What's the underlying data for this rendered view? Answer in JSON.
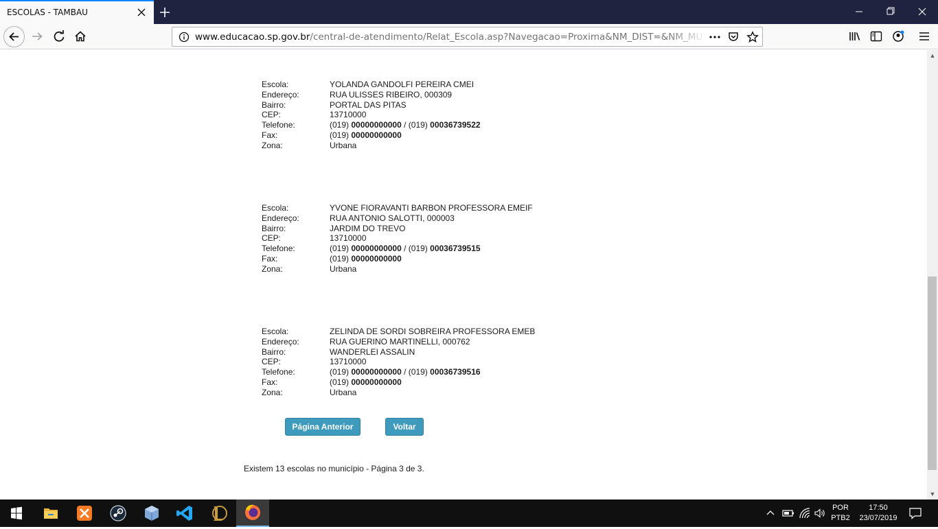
{
  "browser": {
    "tab_title": "ESCOLAS - TAMBAU",
    "url_host": "www.educacao.sp.gov.br",
    "url_rest": "/central-de-atendimento/Relat_Escola.asp?Navegacao=Proxima&NM_DIST=&NM_MUN=TA"
  },
  "labels": {
    "escola": "Escola:",
    "endereco": "Endereço:",
    "bairro": "Bairro:",
    "cep": "CEP:",
    "telefone": "Telefone:",
    "fax": "Fax:",
    "zona": "Zona:"
  },
  "schools": [
    {
      "escola": "YOLANDA GANDOLFI PEREIRA CMEI",
      "endereco": "RUA ULISSES RIBEIRO, 000309",
      "bairro": "PORTAL DAS PITAS",
      "cep": "13710000",
      "tel_ddd1": "(019) ",
      "tel_num1": "00000000000",
      "tel_sep": " / (019) ",
      "tel_num2": "00036739522",
      "fax_ddd": "(019) ",
      "fax_num": "00000000000",
      "zona": "Urbana"
    },
    {
      "escola": "YVONE FIORAVANTI BARBON PROFESSORA EMEIF",
      "endereco": "RUA ANTONIO SALOTTI, 000003",
      "bairro": "JARDIM DO TREVO",
      "cep": "13710000",
      "tel_ddd1": "(019) ",
      "tel_num1": "00000000000",
      "tel_sep": " / (019) ",
      "tel_num2": "00036739515",
      "fax_ddd": "(019) ",
      "fax_num": "00000000000",
      "zona": "Urbana"
    },
    {
      "escola": "ZELINDA DE SORDI SOBREIRA PROFESSORA EMEB",
      "endereco": "RUA GUERINO MARTINELLI, 000762",
      "bairro": "WANDERLEI ASSALIN",
      "cep": "13710000",
      "tel_ddd1": "(019) ",
      "tel_num1": "00000000000",
      "tel_sep": " / (019) ",
      "tel_num2": "00036739516",
      "fax_ddd": "(019) ",
      "fax_num": "00000000000",
      "zona": "Urbana"
    }
  ],
  "buttons": {
    "previous": "Página Anterior",
    "back": "Voltar"
  },
  "footer": "Existem 13 escolas no município - Página 3 de 3.",
  "taskbar": {
    "lang_top": "POR",
    "lang_bottom": "PTB2",
    "time": "17:50",
    "date": "23/07/2019",
    "apps": [
      "windows-start-icon",
      "file-explorer-icon",
      "xampp-icon",
      "steam-icon",
      "virtualbox-icon",
      "vscode-icon",
      "league-of-legends-icon",
      "firefox-icon"
    ]
  },
  "colors": {
    "button_bg": "#3e9bbd",
    "tabbar_bg": "#202340",
    "accent": "#0a84ff"
  }
}
